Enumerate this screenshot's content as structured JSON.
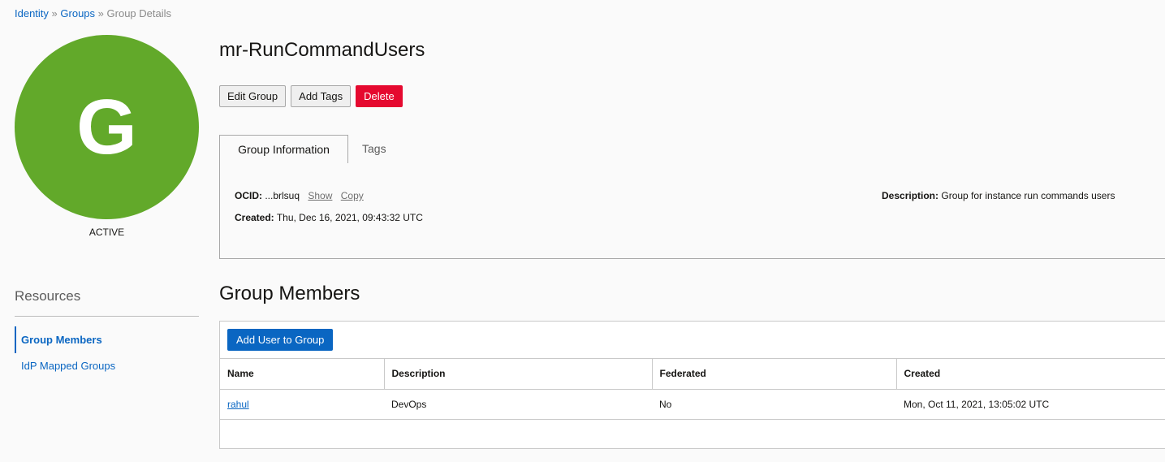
{
  "breadcrumb": {
    "items": [
      "Identity",
      "Groups"
    ],
    "separator": "»",
    "current": "Group Details"
  },
  "avatar": {
    "letter": "G",
    "color": "#62a92a"
  },
  "status": "ACTIVE",
  "title": "mr-RunCommandUsers",
  "actions": {
    "edit": "Edit Group",
    "add_tags": "Add Tags",
    "delete": "Delete"
  },
  "tabs": {
    "info": "Group Information",
    "tags": "Tags"
  },
  "info": {
    "ocid_label": "OCID:",
    "ocid_value": "...brlsuq",
    "show": "Show",
    "copy": "Copy",
    "created_label": "Created:",
    "created_value": "Thu, Dec 16, 2021, 09:43:32 UTC",
    "description_label": "Description:",
    "description_value": "Group for instance run commands users"
  },
  "resources": {
    "heading": "Resources",
    "items": [
      "Group Members",
      "IdP Mapped Groups"
    ]
  },
  "members": {
    "title": "Group Members",
    "add_button": "Add User to Group",
    "columns": [
      "Name",
      "Description",
      "Federated",
      "Created"
    ],
    "rows": [
      {
        "name": "rahul",
        "description": "DevOps",
        "federated": "No",
        "created": "Mon, Oct 11, 2021, 13:05:02 UTC"
      }
    ]
  },
  "colors": {
    "accent": "#0a66c2",
    "danger": "#e5092f",
    "avatar": "#62a92a"
  }
}
